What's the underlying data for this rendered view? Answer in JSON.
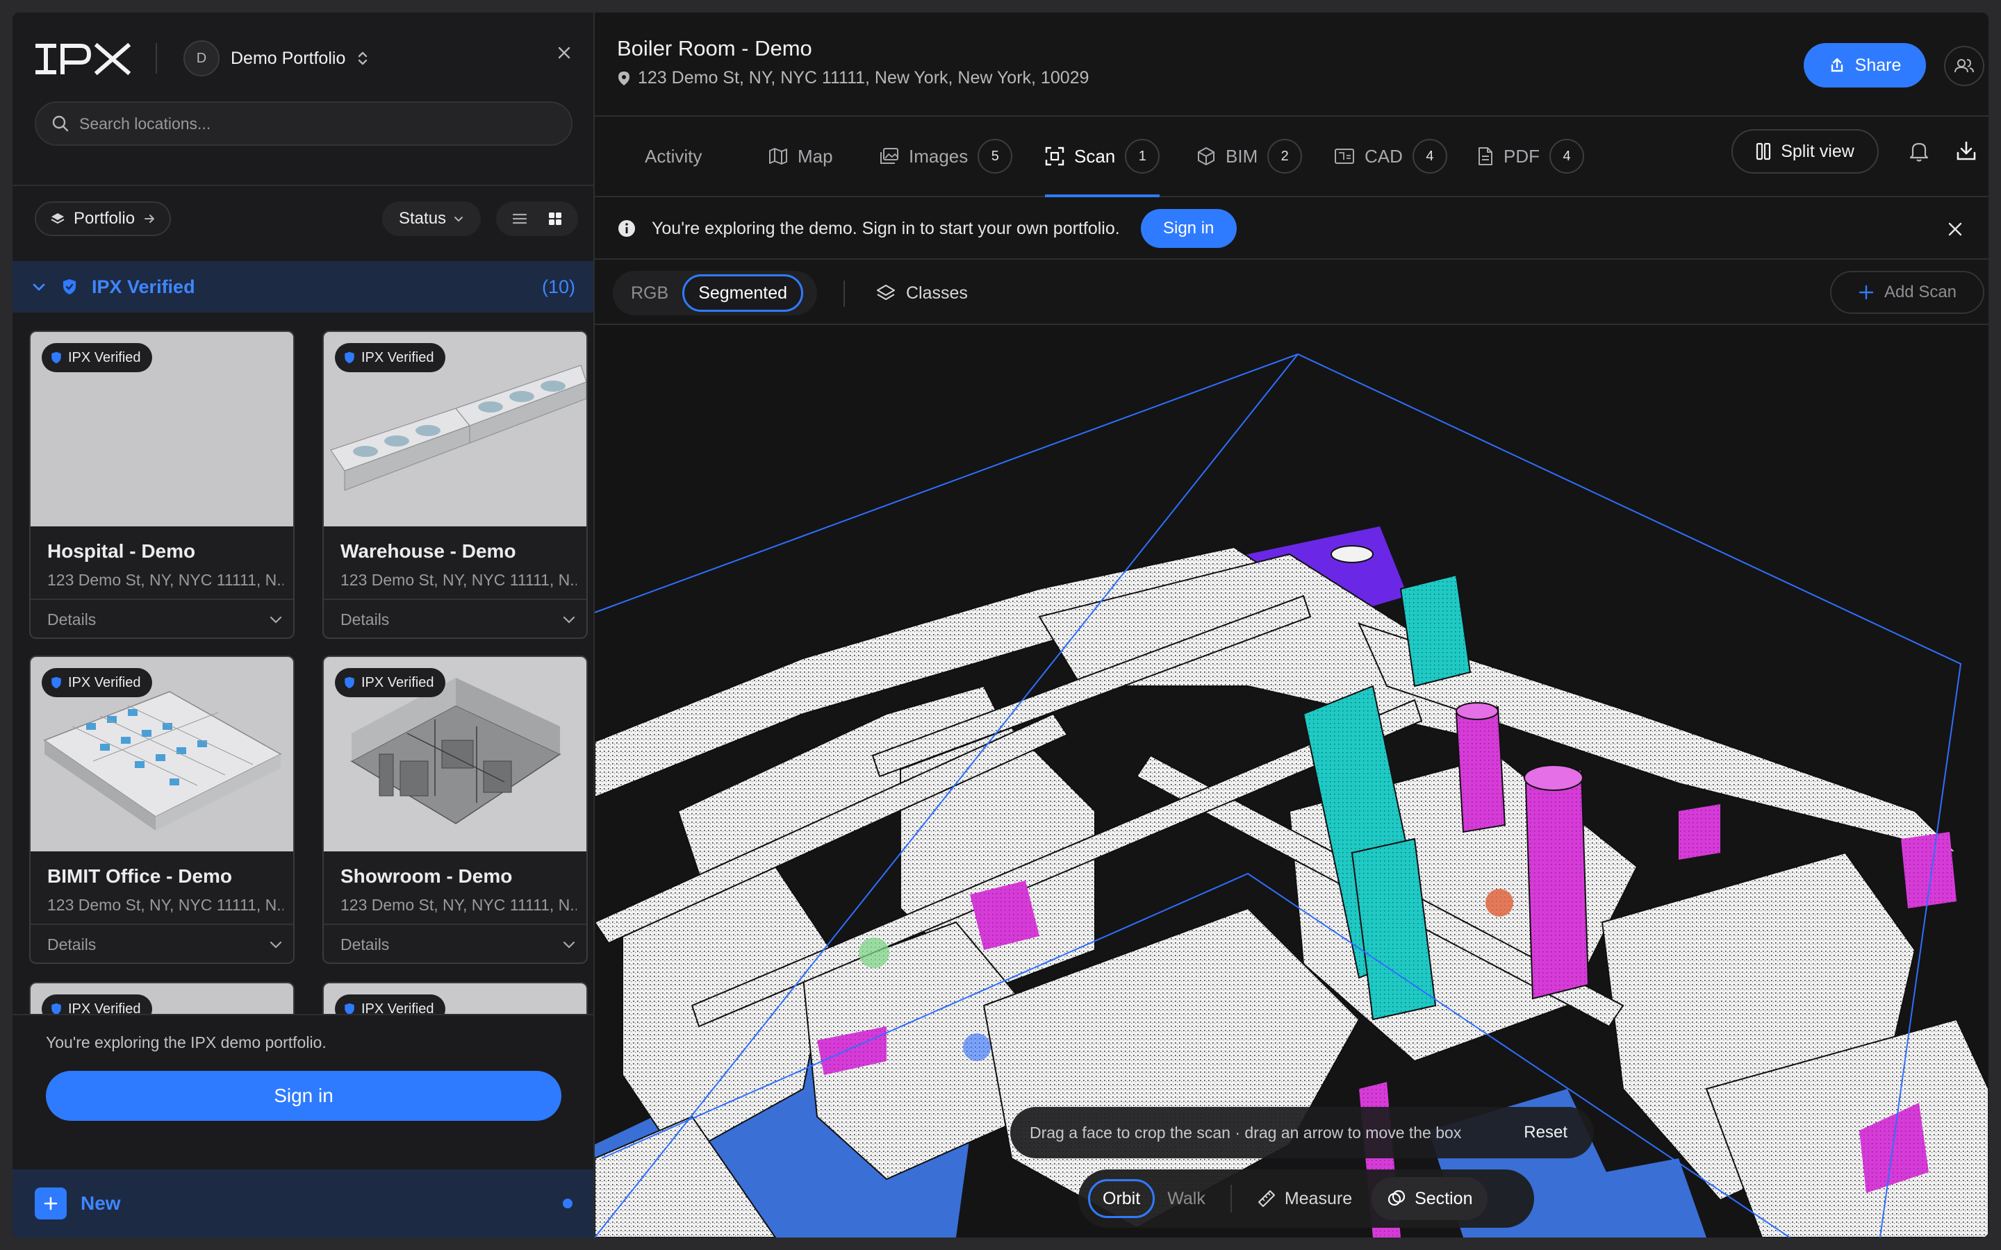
{
  "sidebar": {
    "portfolio_switch": {
      "avatar_letter": "D",
      "label": "Demo Portfolio"
    },
    "search": {
      "placeholder": "Search locations..."
    },
    "toolbar": {
      "portfolio_label": "Portfolio",
      "status_label": "Status"
    },
    "group": {
      "label": "IPX Verified",
      "count": "(10)"
    },
    "cards": [
      {
        "badge": "IPX Verified",
        "title": "Hospital - Demo",
        "address": "123 Demo St, NY, NYC 11111, N...",
        "details": "Details"
      },
      {
        "badge": "IPX Verified",
        "title": "Warehouse - Demo",
        "address": "123 Demo St, NY, NYC 11111, N...",
        "details": "Details"
      },
      {
        "badge": "IPX Verified",
        "title": "BIMIT Office - Demo",
        "address": "123 Demo St, NY, NYC 11111, N...",
        "details": "Details"
      },
      {
        "badge": "IPX Verified",
        "title": "Showroom - Demo",
        "address": "123 Demo St, NY, NYC 11111, N...",
        "details": "Details"
      },
      {
        "badge": "IPX Verified"
      },
      {
        "badge": "IPX Verified"
      }
    ],
    "bottom": {
      "message": "You're exploring the IPX demo portfolio.",
      "signin_label": "Sign in"
    },
    "new_label": "New"
  },
  "header": {
    "title": "Boiler Room - Demo",
    "address": "123 Demo St, NY, NYC 11111, New York, New York, 10029",
    "share_label": "Share"
  },
  "tabs": [
    {
      "label": "Activity",
      "icon": "none"
    },
    {
      "label": "Map",
      "icon": "map-icon"
    },
    {
      "label": "Images",
      "icon": "images-icon",
      "count": "5"
    },
    {
      "label": "Scan",
      "icon": "scan-icon",
      "count": "1",
      "active": true
    },
    {
      "label": "BIM",
      "icon": "cube-icon",
      "count": "2"
    },
    {
      "label": "CAD",
      "icon": "cad-icon",
      "count": "4"
    },
    {
      "label": "PDF",
      "icon": "file-icon",
      "count": "4"
    }
  ],
  "split_view_label": "Split view",
  "banner": {
    "message": "You're exploring the demo. Sign in to start your own portfolio.",
    "signin_label": "Sign in"
  },
  "view_bar": {
    "modes": [
      "RGB",
      "Segmented"
    ],
    "active_mode": "Segmented",
    "classes_label": "Classes",
    "add_scan_label": "Add Scan"
  },
  "viewport": {
    "hint_text": "Drag a face to crop the scan · drag an arrow to move the box",
    "reset_label": "Reset",
    "nav_modes": [
      "Orbit",
      "Walk"
    ],
    "active_nav": "Orbit",
    "measure_label": "Measure",
    "section_label": "Section",
    "segment_colors": {
      "pipes": "#f4f4f4",
      "magenta": "#d63bd8",
      "cyan": "#1fc9c4",
      "purple": "#6a28e6",
      "blue": "#3a6fd6",
      "box_edge": "#2f6fff"
    }
  },
  "colors": {
    "accent": "#2f7bff",
    "background": "#161617",
    "verified_header": "#1c2a44"
  }
}
